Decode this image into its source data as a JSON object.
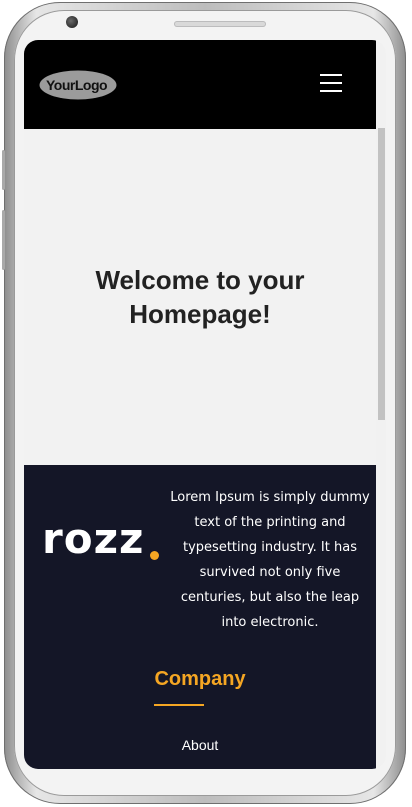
{
  "header": {
    "logo_text": "YourLogo",
    "menu_icon": "hamburger-icon"
  },
  "hero": {
    "title": "Welcome to your Homepage!"
  },
  "footer": {
    "brand": "rozz",
    "description": "Lorem Ipsum is simply dummy text of the printing and typesetting industry. It has survived not only five centuries, but also the leap into electronic.",
    "company_heading": "Company",
    "links": [
      "About"
    ]
  },
  "colors": {
    "header_bg": "#000000",
    "hero_bg": "#f2f2f2",
    "footer_bg": "#141627",
    "accent": "#f5a623"
  }
}
